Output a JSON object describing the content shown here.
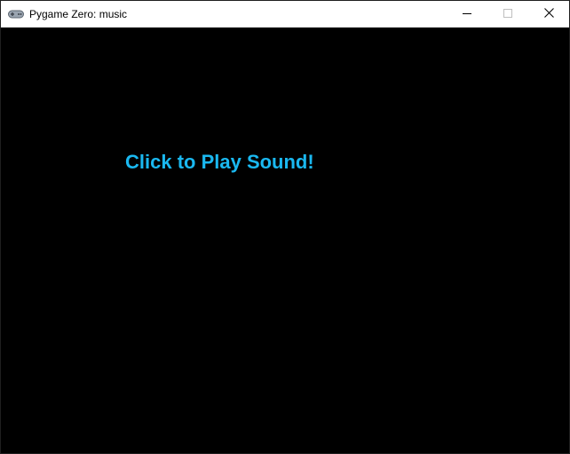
{
  "window": {
    "title": "Pygame Zero: music",
    "icon": "gamepad-icon"
  },
  "controls": {
    "minimize_icon": "minimize-icon",
    "maximize_icon": "maximize-icon",
    "close_icon": "close-icon"
  },
  "game": {
    "background_color": "#000000",
    "prompt_text": "Click to Play Sound!",
    "prompt_color": "#1ab8f0"
  }
}
